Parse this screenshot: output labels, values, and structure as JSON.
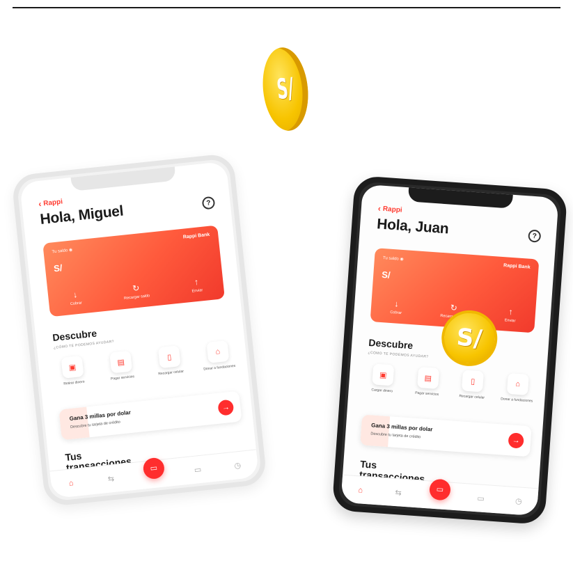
{
  "coin": {
    "symbol": "S/"
  },
  "phone_left": {
    "back": "Rappi",
    "greeting": "Hola, Miguel",
    "card": {
      "balance_label": "Tu saldo",
      "bank": "Rappi Bank",
      "currency": "S/",
      "actions": [
        "Cobrar",
        "Recargar saldo",
        "Enviar"
      ]
    },
    "discover": {
      "title": "Descubre",
      "subtitle": "¿CÓMO TE PODEMOS AYUDAR?"
    },
    "services": [
      "Retirar dinero",
      "Pagar servicios",
      "Recargar celular",
      "Donar a fundaciones"
    ],
    "promo": {
      "title": "Gana 3 millas por dolar",
      "subtitle": "Descubre tu tarjeta de crédito"
    },
    "transactions": {
      "line1": "Tus",
      "line2": "transacciones"
    }
  },
  "phone_right": {
    "back": "Rappi",
    "greeting": "Hola, Juan",
    "card": {
      "balance_label": "Tu saldo",
      "bank": "Rappi Bank",
      "currency": "S/",
      "actions": [
        "Cobrar",
        "Recargar saldo",
        "Enviar"
      ]
    },
    "discover": {
      "title": "Descubre",
      "subtitle": "¿CÓMO TE PODEMOS AYUDAR?"
    },
    "services": [
      "Cargar dinero",
      "Pagar servicios",
      "Recargar celular",
      "Donar a fundaciones"
    ],
    "promo": {
      "title": "Gana 3 millas por dolar",
      "subtitle": "Descubre tu tarjeta de crédito"
    },
    "transactions": {
      "line1": "Tus",
      "line2": "transacciones"
    }
  },
  "colors": {
    "accent": "#ff2d2d",
    "card_start": "#ff8a5c",
    "card_end": "#f13a2c",
    "coin": "#f7c400"
  },
  "icons": {
    "nav": [
      "home-icon",
      "transfer-icon",
      "rappi-card-icon",
      "wallet-icon",
      "clock-icon"
    ],
    "services": [
      "cash-icon",
      "receipt-icon",
      "phone-icon",
      "bank-icon"
    ]
  }
}
